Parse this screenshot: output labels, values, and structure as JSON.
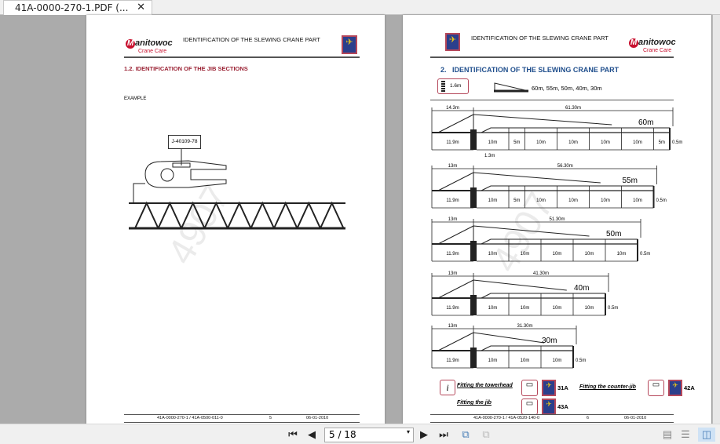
{
  "tab": {
    "title": "41A-0000-270-1.PDF (...",
    "close": "✕"
  },
  "left_page": {
    "header_title": "IDENTIFICATION OF THE SLEWING CRANE PART",
    "logo_brand": "anitowoc",
    "logo_m": "M",
    "logo_sub": "Crane Care",
    "section_heading": "1.2. IDENTIFICATION OF THE JIB SECTIONS",
    "example_label": "EXAMPLE",
    "tag_label": "J-40109-78",
    "footer": {
      "doc": "41A-0000-270-1 / 41A-0500-011-0",
      "page": "5",
      "date": "06-01-2010"
    },
    "watermark": "4907"
  },
  "right_page": {
    "header_title": "IDENTIFICATION OF THE SLEWING CRANE PART",
    "logo_brand": "anitowoc",
    "logo_m": "M",
    "logo_sub": "Crane Care",
    "section_heading": "2.   IDENTIFICATION OF THE SLEWING CRANE PART",
    "mast_label": "1.6m",
    "jib_lengths": "60m, 55m, 50m, 40m, 30m",
    "mast_offset_label": "1.3m",
    "jibs": [
      {
        "name": "60m",
        "counter_dim": "14.3m",
        "total_dim": "61.30m",
        "counter_len": "11.9m",
        "sections": [
          "10m",
          "5m",
          "10m",
          "10m",
          "10m",
          "10m",
          "5m"
        ],
        "section_m": [
          10,
          5,
          10,
          10,
          10,
          10,
          5
        ],
        "tip": "0.5m"
      },
      {
        "name": "55m",
        "counter_dim": "13m",
        "total_dim": "56.30m",
        "counter_len": "11.9m",
        "sections": [
          "10m",
          "5m",
          "10m",
          "10m",
          "10m",
          "10m"
        ],
        "section_m": [
          10,
          5,
          10,
          10,
          10,
          10
        ],
        "tip": "0.5m"
      },
      {
        "name": "50m",
        "counter_dim": "13m",
        "total_dim": "51.30m",
        "counter_len": "11.9m",
        "sections": [
          "10m",
          "10m",
          "10m",
          "10m",
          "10m"
        ],
        "section_m": [
          10,
          10,
          10,
          10,
          10
        ],
        "tip": "0.5m"
      },
      {
        "name": "40m",
        "counter_dim": "13m",
        "total_dim": "41.30m",
        "counter_len": "11.9m",
        "sections": [
          "10m",
          "10m",
          "10m",
          "10m"
        ],
        "section_m": [
          10,
          10,
          10,
          10
        ],
        "tip": "0.5m"
      },
      {
        "name": "30m",
        "counter_dim": "13m",
        "total_dim": "31.30m",
        "counter_len": "11.9m",
        "sections": [
          "10m",
          "10m",
          "10m"
        ],
        "section_m": [
          10,
          10,
          10
        ],
        "tip": "0.5m"
      }
    ],
    "refs": {
      "info": "i",
      "towerhead": "Fitting the towerhead",
      "towerhead_ref": "31A",
      "counter_jib": "Fitting the counter-jib",
      "counter_jib_ref": "42A",
      "jib": "Fitting the jib",
      "jib_ref": "43A"
    },
    "footer": {
      "doc": "41A-0000-270-1 / 41A-0520-140-0",
      "page": "6",
      "date": "06-01-2010"
    },
    "watermark": "4907"
  },
  "toolbar": {
    "first": "⏮",
    "prev": "◀",
    "page_value": "5 / 18",
    "dropdown": "▾",
    "next": "▶",
    "last": "⏭"
  },
  "colors": {
    "left_heading": "#9b2335",
    "right_heading": "#1f4e8c",
    "badge": "#2b3f8c"
  }
}
